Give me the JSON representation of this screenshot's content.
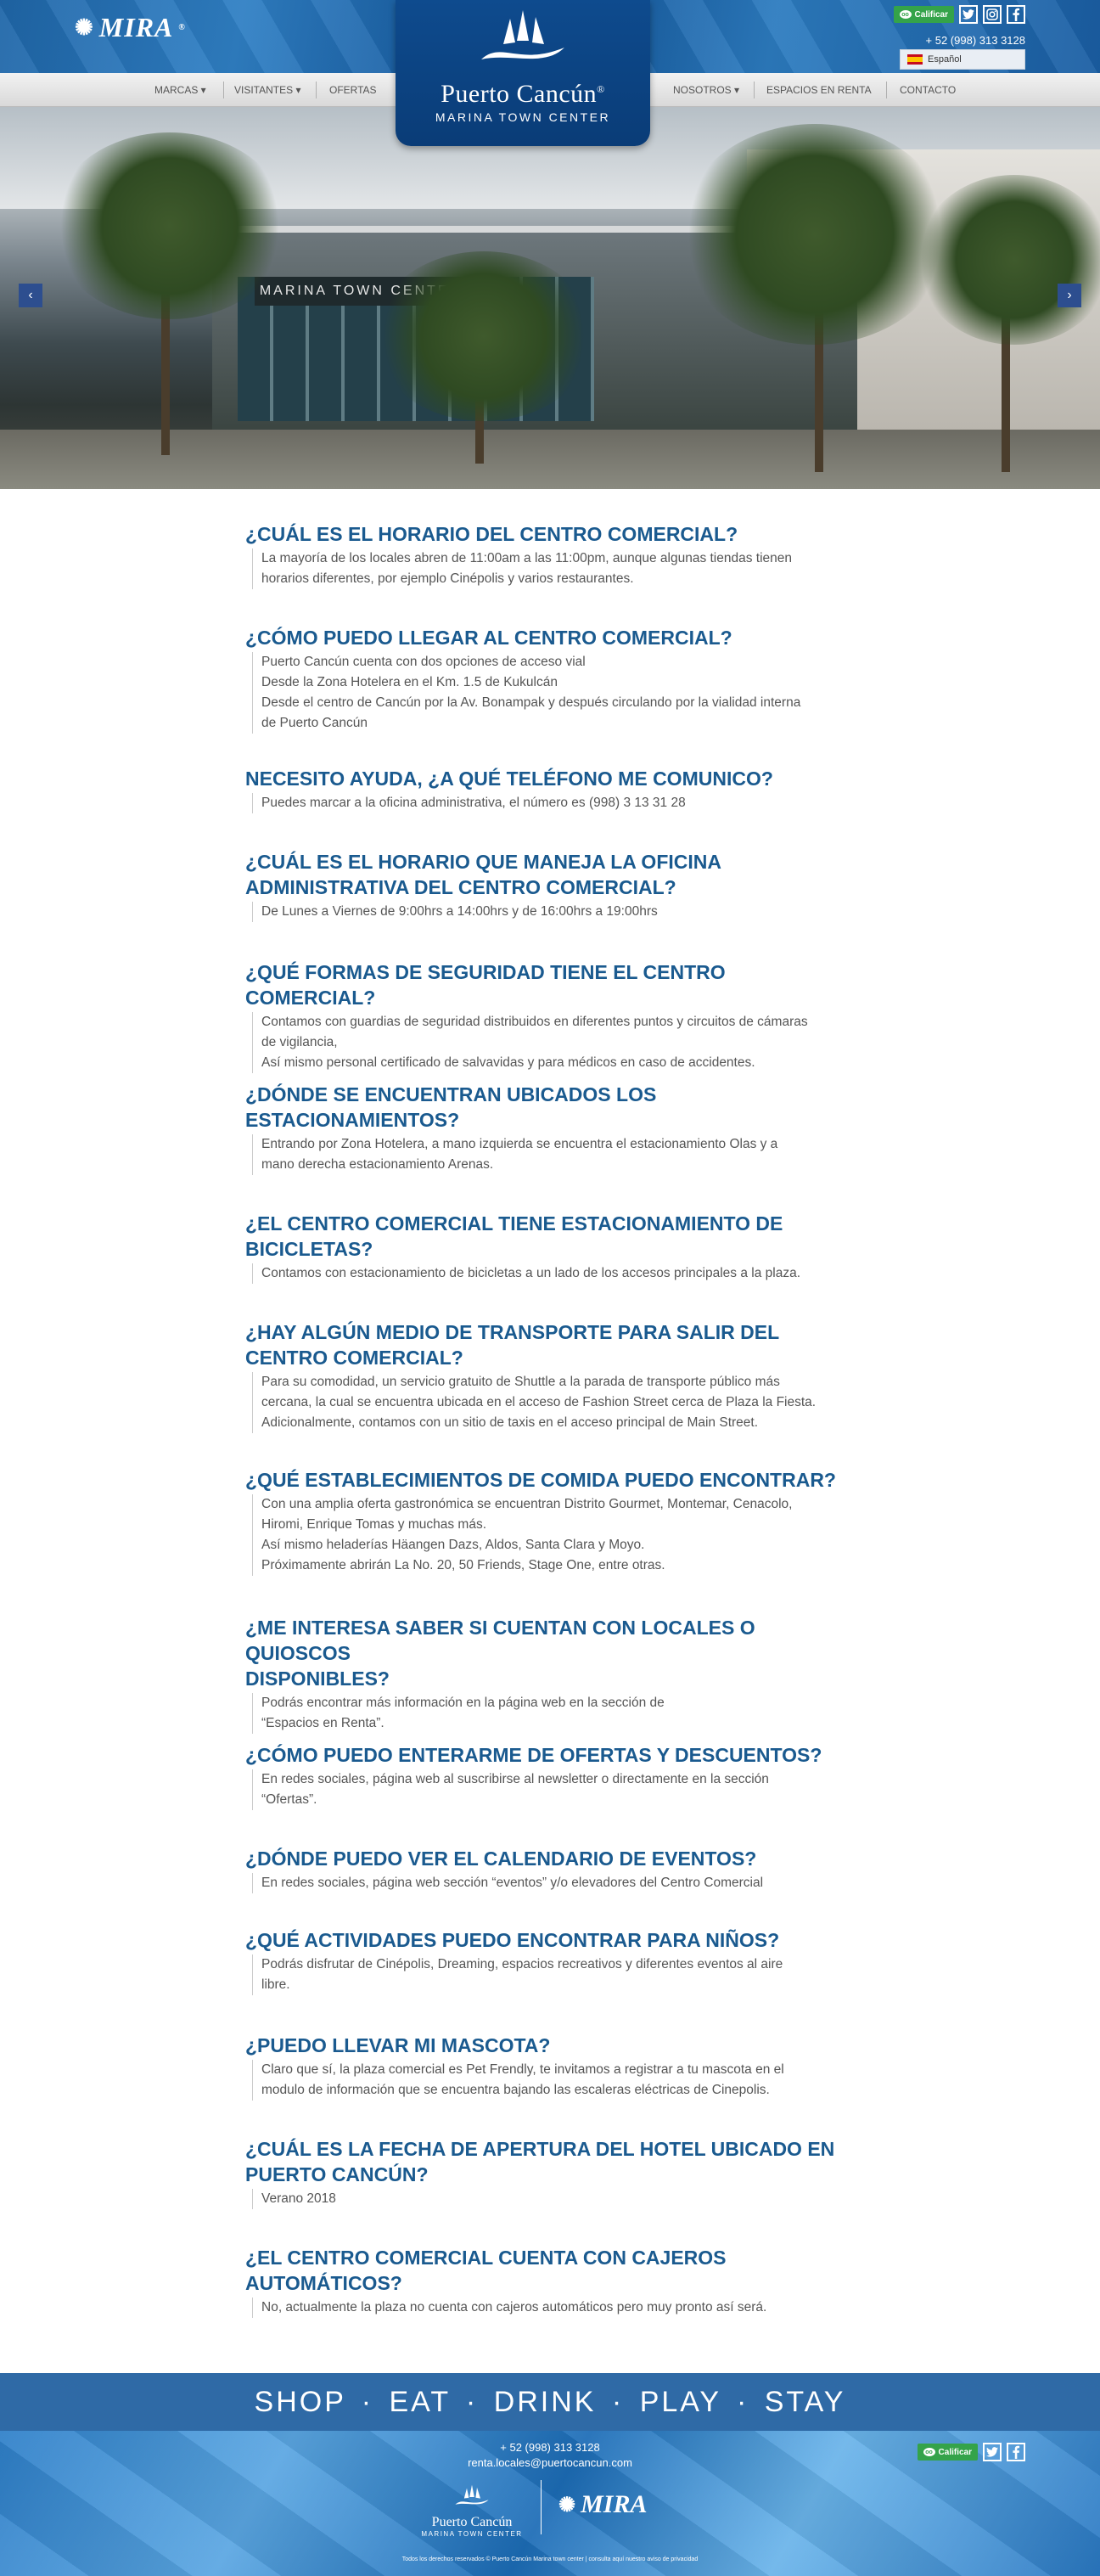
{
  "header": {
    "mira_logo": "MIRA",
    "mira_reg": "®",
    "tripadvisor_label": "Calificar",
    "phone": "+ 52 (998) 313 3128",
    "language": "Español"
  },
  "brand": {
    "title": "Puerto Cancún",
    "reg": "®",
    "subtitle": "MARINA TOWN CENTER"
  },
  "nav": {
    "items": [
      "MARCAS ▾",
      "VISITANTES ▾",
      "OFERTAS",
      "NOSOTROS ▾",
      "ESPACIOS EN RENTA",
      "CONTACTO"
    ]
  },
  "hero": {
    "sign": "MARINA TOWN CENTER",
    "active_slide": 4,
    "slide_count": 5
  },
  "faq": [
    {
      "q": [
        "¿CUÁL ES EL HORARIO DEL CENTRO COMERCIAL?"
      ],
      "a": [
        "La mayoría de los locales abren de 11:00am a las 11:00pm, aunque algunas tiendas tienen",
        "horarios diferentes, por ejemplo Cinépolis y varios restaurantes."
      ]
    },
    {
      "q": [
        "¿CÓMO PUEDO LLEGAR AL CENTRO COMERCIAL?"
      ],
      "a": [
        "Puerto Cancún cuenta con dos opciones de acceso vial",
        "Desde la Zona Hotelera en el Km. 1.5 de Kukulcán",
        "Desde el centro de Cancún por la Av. Bonampak y después circulando por la vialidad interna",
        "de Puerto Cancún"
      ]
    },
    {
      "q": [
        "NECESITO AYUDA, ¿A QUÉ TELÉFONO ME COMUNICO?"
      ],
      "a": [
        "Puedes marcar a la oficina administrativa, el número es (998) 3 13 31 28"
      ]
    },
    {
      "q": [
        "¿CUÁL ES EL HORARIO QUE MANEJA LA OFICINA",
        "ADMINISTRATIVA DEL CENTRO COMERCIAL?"
      ],
      "a": [
        "De Lunes a Viernes de 9:00hrs a 14:00hrs y de 16:00hrs a 19:00hrs"
      ]
    },
    {
      "q": [
        "¿QUÉ FORMAS DE SEGURIDAD TIENE EL CENTRO COMERCIAL?"
      ],
      "a": [
        "Contamos con guardias de seguridad distribuidos en diferentes puntos y circuitos de cámaras",
        "de vigilancia,",
        "Así mismo personal certificado de salvavidas y para médicos en caso de accidentes."
      ]
    },
    {
      "q": [
        "¿DÓNDE SE ENCUENTRAN UBICADOS LOS",
        "ESTACIONAMIENTOS?"
      ],
      "a": [
        "Entrando por Zona Hotelera, a mano izquierda se encuentra el estacionamiento Olas y a",
        "mano derecha estacionamiento Arenas."
      ]
    },
    {
      "q": [
        "¿EL CENTRO COMERCIAL TIENE ESTACIONAMIENTO DE",
        "BICICLETAS?"
      ],
      "a": [
        "Contamos con estacionamiento de bicicletas a un lado de los accesos principales a la plaza."
      ]
    },
    {
      "q": [
        "¿HAY ALGÚN MEDIO DE TRANSPORTE PARA SALIR DEL",
        "CENTRO COMERCIAL?"
      ],
      "a": [
        "Para su comodidad, un servicio gratuito de Shuttle a la parada de transporte público más",
        "cercana, la cual se encuentra ubicada en el acceso de Fashion Street cerca de Plaza la Fiesta.",
        "Adicionalmente, contamos con un sitio de taxis en el acceso principal de Main Street."
      ]
    },
    {
      "q": [
        "¿QUÉ ESTABLECIMIENTOS DE COMIDA PUEDO ENCONTRAR?"
      ],
      "a": [
        "Con una amplia oferta gastronómica se encuentran Distrito Gourmet, Montemar, Cenacolo,",
        "Hiromi, Enrique Tomas y muchas más.",
        "Así mismo heladerías Häangen Dazs, Aldos, Santa Clara y Moyo.",
        "Próximamente abrirán La No. 20, 50 Friends, Stage One, entre otras."
      ]
    },
    {
      "q": [
        "¿ME INTERESA SABER SI CUENTAN CON LOCALES O QUIOSCOS",
        "DISPONIBLES?"
      ],
      "a": [
        "Podrás encontrar más información en la página web en la sección de",
        "“Espacios en Renta”."
      ]
    },
    {
      "q": [
        "¿CÓMO PUEDO ENTERARME DE OFERTAS Y DESCUENTOS?"
      ],
      "a": [
        "En redes sociales, página web al suscribirse al newsletter o directamente en la sección",
        "“Ofertas”."
      ]
    },
    {
      "q": [
        "¿DÓNDE PUEDO VER EL CALENDARIO DE EVENTOS?"
      ],
      "a": [
        "En redes sociales, página web sección “eventos” y/o elevadores del Centro Comercial"
      ]
    },
    {
      "q": [
        "¿QUÉ ACTIVIDADES PUEDO ENCONTRAR PARA NIÑOS?"
      ],
      "a": [
        "Podrás disfrutar de Cinépolis, Dreaming, espacios recreativos y diferentes eventos al aire",
        "libre."
      ]
    },
    {
      "q": [
        "¿PUEDO LLEVAR MI MASCOTA?"
      ],
      "a": [
        "Claro que sí, la plaza comercial es Pet Frendly, te invitamos a registrar a tu mascota en el",
        "modulo de información que se encuentra bajando las escaleras eléctricas de Cinepolis."
      ]
    },
    {
      "q": [
        "¿CUÁL ES LA FECHA DE APERTURA DEL HOTEL UBICADO EN",
        "PUERTO CANCÚN?"
      ],
      "a": [
        "Verano 2018"
      ]
    },
    {
      "q": [
        "¿EL CENTRO COMERCIAL CUENTA CON CAJEROS",
        "AUTOMÁTICOS?"
      ],
      "a": [
        "No, actualmente la plaza no cuenta con cajeros automáticos pero muy pronto así será."
      ]
    }
  ],
  "footer": {
    "tagline": "SHOP · EAT · DRINK · PLAY · STAY",
    "phone": "+ 52 (998) 313 3128",
    "email": "renta.locales@puertocancun.com",
    "tripadvisor_label": "Calificar",
    "logo_title": "Puerto Cancún",
    "logo_subtitle": "MARINA TOWN CENTER",
    "mira": "MIRA",
    "copyright": "Todos los derechos reservados © Puerto Cancún Marina town center | consulta aquí nuestro aviso de privacidad"
  }
}
